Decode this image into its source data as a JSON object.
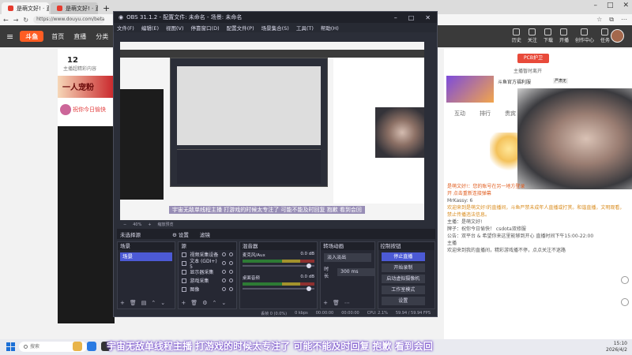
{
  "browser": {
    "tabs": [
      {
        "label": "是萌文好! · 直播"
      },
      {
        "label": "是萌文好! · 直播"
      }
    ],
    "new_tab": "+",
    "url": "https://www.douyu.com/beta/1334760"
  },
  "site": {
    "menu_icon": "≡",
    "logo": "斗鱼",
    "nav": [
      "首页",
      "直播",
      "分类"
    ],
    "right_items": [
      "历史",
      "关注",
      "下载",
      "开播",
      "创作中心",
      "任务"
    ]
  },
  "page_left": {
    "count": "12",
    "count_sub": "主播超精彩内容",
    "banner_text": "一人宠粉",
    "gift_text": "祝你今日愉快"
  },
  "page_right": {
    "pcb_badge": "PCB护卫",
    "pcb_sub": "主播暂时离开",
    "banner_title": "斗鱼官方福利服",
    "banner_chip": "严肃无",
    "tabs": [
      "互动",
      "排行",
      "贵宾"
    ],
    "chat_lines": [
      {
        "text": "是萌文好!：您的账号在另一地方登录",
        "cls": "hl"
      },
      {
        "text": "开 点击重新连接弹幕",
        "cls": "hl"
      },
      {
        "text": "MrKassy: 6",
        "cls": ""
      },
      {
        "text": "欢迎来到是萌文好!的直播间，斗鱼严禁未成年人直播或打赏。和谐直播，文明观看，禁止传播违法信息。",
        "cls": "notice"
      },
      {
        "text": "主播：是萌文好!",
        "cls": ""
      },
      {
        "text": "牌子：祝你今日愉快！ csdota双修服",
        "cls": ""
      },
      {
        "text": "公告：双平台 & 希望你来这里能够到开心 直播时间下午15:00-22:00",
        "cls": ""
      },
      {
        "text": "主播",
        "cls": ""
      },
      {
        "text": "欢迎来到我的直播间，精彩游戏播不停，点点关注不迷路",
        "cls": ""
      }
    ]
  },
  "obs": {
    "title": "OBS 31.1.2 - 配置文件: 未命名 - 场景: 未命名",
    "menu": [
      "文件(F)",
      "编辑(E)",
      "视图(V)",
      "停靠窗口(D)",
      "配置文件(P)",
      "场景集合(S)",
      "工具(T)",
      "帮助(H)"
    ],
    "preview_caption": "宇宙无敌单线程主播 打游戏的时候太专注了 可能不能及时回复 抱歉 看到会回",
    "zoom_label": "40%",
    "zoom_note": "缩放预览",
    "scene_bar": {
      "label": "未选择源",
      "props": "⚙ 设置",
      "filters": "滤镜"
    },
    "docks": {
      "scenes_title": "场景",
      "scene_items": [
        "场景"
      ],
      "sources_title": "源",
      "source_items": [
        "视频采集设备",
        "文本 (GDI+) 5",
        "显示器采集",
        "游戏采集",
        "图像"
      ],
      "mixer_title": "混音器",
      "mixer_channels": [
        {
          "name": "麦克风/Aux",
          "db": "0.0 dB",
          "level": 0.8
        },
        {
          "name": "桌面音频",
          "db": "0.0 dB",
          "level": 0.8
        }
      ],
      "transitions_title": "转场动画",
      "transition_type": "淡入淡出",
      "duration_label": "时长",
      "duration_value": "300 ms",
      "controls_title": "控制按钮",
      "controls": [
        "停止直播",
        "开始录制",
        "启动虚拟摄像机",
        "工作室模式",
        "设置"
      ]
    },
    "status": {
      "frames": "丢帧 0 (0.0%)",
      "kbps": "0 kbps",
      "rec_time": "00:00:00",
      "live_time": "00:00:00",
      "cpu": "CPU: 2.1%",
      "fps": "59.94 / 59.94 FPS"
    }
  },
  "overlay_caption": "宇宙无敌单线程主播 打游戏的时候太专注了 可能不能及时回复 抱歉 看到会回",
  "taskbar": {
    "search_placeholder": "搜索",
    "time": "15:10",
    "date": "2026/4/2"
  }
}
